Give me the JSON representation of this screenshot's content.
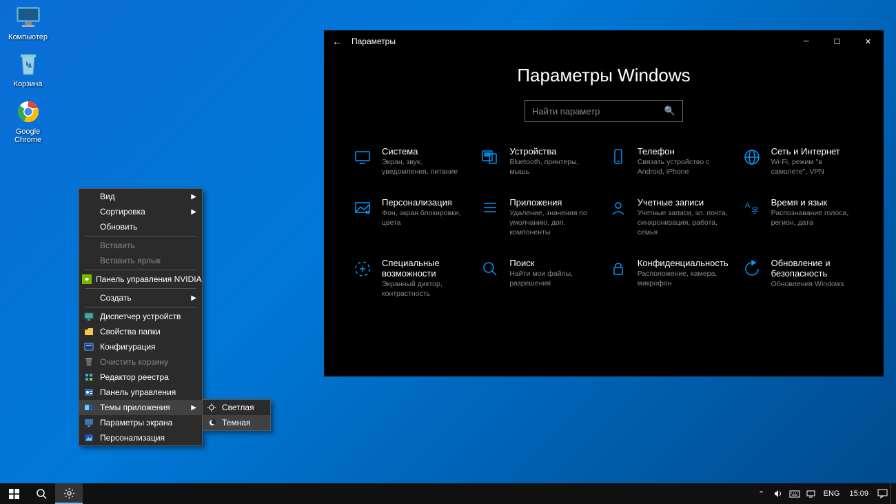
{
  "desktop": {
    "icons": [
      {
        "name": "computer-icon",
        "label": "Компьютер"
      },
      {
        "name": "recycle-bin-icon",
        "label": "Корзина"
      },
      {
        "name": "chrome-icon",
        "label": "Google Chrome"
      }
    ]
  },
  "context_menu": {
    "items": [
      {
        "label": "Вид",
        "arrow": true
      },
      {
        "label": "Сортировка",
        "arrow": true
      },
      {
        "label": "Обновить"
      },
      {
        "sep": true
      },
      {
        "label": "Вставить",
        "disabled": true
      },
      {
        "label": "Вставить ярлык",
        "disabled": true
      },
      {
        "sep": true
      },
      {
        "label": "Панель управления NVIDIA",
        "icon": "nvidia"
      },
      {
        "sep": true
      },
      {
        "label": "Создать",
        "arrow": true
      },
      {
        "sep": true
      },
      {
        "label": "Диспетчер устройств",
        "icon": "device"
      },
      {
        "label": "Свойства папки",
        "icon": "folder"
      },
      {
        "label": "Конфигурация",
        "icon": "config"
      },
      {
        "label": "Очистить корзину",
        "disabled": true,
        "icon": "trash"
      },
      {
        "label": "Редактор реестра",
        "icon": "regedit"
      },
      {
        "label": "Панель управления",
        "icon": "control"
      },
      {
        "label": "Темы приложения",
        "icon": "theme",
        "arrow": true,
        "highlight": true,
        "submenu": true
      },
      {
        "label": "Параметры экрана",
        "icon": "display"
      },
      {
        "label": "Персонализация",
        "icon": "personalize"
      }
    ],
    "submenu": {
      "items": [
        {
          "label": "Светлая",
          "icon": "sun"
        },
        {
          "label": "Темная",
          "icon": "moon",
          "highlight": true
        }
      ]
    }
  },
  "settings": {
    "title": "Параметры",
    "header": "Параметры Windows",
    "search_placeholder": "Найти параметр",
    "categories": [
      {
        "title": "Система",
        "desc": "Экран, звук, уведомления, питание",
        "icon": "system"
      },
      {
        "title": "Устройства",
        "desc": "Bluetooth, принтеры, мышь",
        "icon": "devices"
      },
      {
        "title": "Телефон",
        "desc": "Связать устройство с Android, iPhone",
        "icon": "phone"
      },
      {
        "title": "Сеть и Интернет",
        "desc": "Wi-Fi, режим \"в самолете\", VPN",
        "icon": "network"
      },
      {
        "title": "Персонализация",
        "desc": "Фон, экран блокировки, цвета",
        "icon": "personalization"
      },
      {
        "title": "Приложения",
        "desc": "Удаление, значения по умолчанию, доп. компоненты",
        "icon": "apps"
      },
      {
        "title": "Учетные записи",
        "desc": "Учетные записи, эл. почта, синхронизация, работа, семья",
        "icon": "accounts"
      },
      {
        "title": "Время и язык",
        "desc": "Распознавание голоса, регион, дата",
        "icon": "time"
      },
      {
        "title": "Специальные возможности",
        "desc": "Экранный диктор, контрастность",
        "icon": "ease"
      },
      {
        "title": "Поиск",
        "desc": "Найти мои файлы, разрешения",
        "icon": "searchcat"
      },
      {
        "title": "Конфиденциальность",
        "desc": "Расположение, камера, микрофон",
        "icon": "privacy"
      },
      {
        "title": "Обновление и безопасность",
        "desc": "Обновления Windows",
        "icon": "update"
      }
    ]
  },
  "taskbar": {
    "lang": "ENG",
    "clock": "15:09"
  }
}
